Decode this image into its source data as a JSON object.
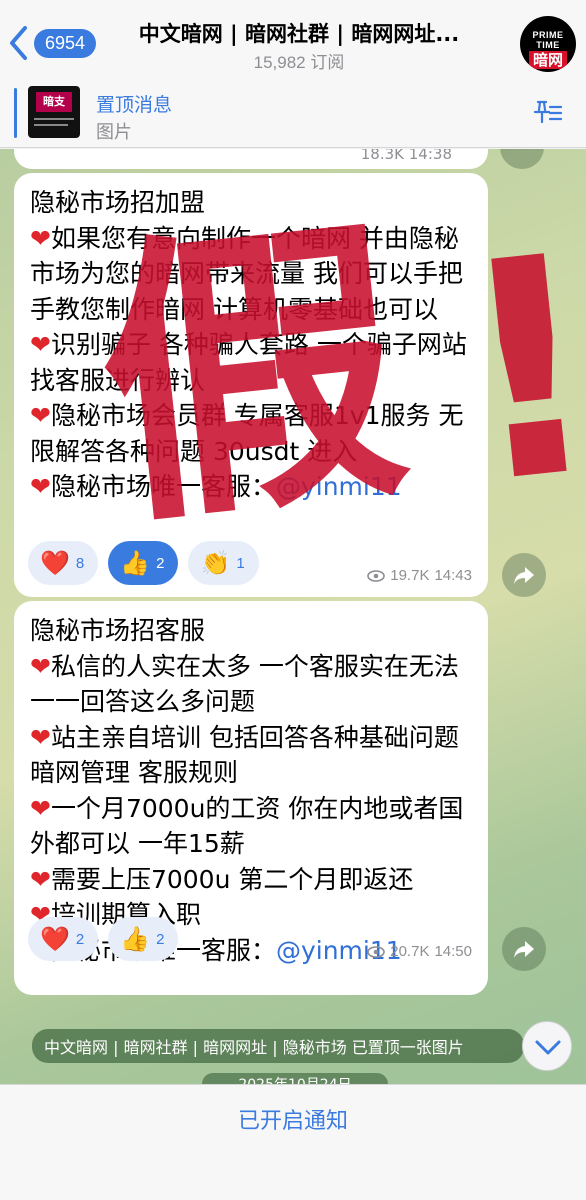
{
  "header": {
    "back_count": "6954",
    "title": "中文暗网 | 暗网社群 | 暗网网址...",
    "subscribers": "15,982 订阅",
    "avatar_line1": "PRIME TIME",
    "avatar_line2": "暗网"
  },
  "pinned": {
    "title": "置顶消息",
    "subtitle": "图片",
    "thumb_label": "暗支",
    "icon": "pin-list-icon"
  },
  "previous_message": {
    "meta": "18.3K 14:38"
  },
  "messages": [
    {
      "lines": [
        {
          "heart": false,
          "text": "隐秘市场招加盟"
        },
        {
          "heart": true,
          "text": "如果您有意向制作一个暗网 并由隐秘市场为您的暗网带来流量 我们可以手把手教您制作暗网 计算机零基础也可以"
        },
        {
          "heart": true,
          "text": "识别骗子 各种骗人套路 一个骗子网站 找客服进行辨认"
        },
        {
          "heart": true,
          "text": "隐秘市场会员群 专属客服1v1服务 无限解答各种问题 30usdt 进入"
        },
        {
          "heart": true,
          "text": "隐秘市场唯一客服：",
          "mention": "@yinmi11"
        }
      ],
      "reactions": [
        {
          "emoji": "❤️",
          "count": "8",
          "active": false
        },
        {
          "emoji": "👍",
          "count": "2",
          "active": true
        },
        {
          "emoji": "👏",
          "count": "1",
          "active": false
        }
      ],
      "views": "19.7K",
      "time": "14:43"
    },
    {
      "lines": [
        {
          "heart": false,
          "text": "隐秘市场招客服"
        },
        {
          "heart": true,
          "text": "私信的人实在太多 一个客服实在无法一一回答这么多问题"
        },
        {
          "heart": true,
          "text": "站主亲自培训 包括回答各种基础问题 暗网管理 客服规则"
        },
        {
          "heart": true,
          "text": "一个月7000u的工资 你在内地或者国外都可以 一年15薪"
        },
        {
          "heart": true,
          "text": "需要上压7000u 第二个月即返还"
        },
        {
          "heart": true,
          "text": "培训期算入职"
        },
        {
          "heart": true,
          "text": "隐秘市场唯一客服：",
          "mention": "@yinmi11"
        }
      ],
      "reactions": [
        {
          "emoji": "❤️",
          "count": "2",
          "active": false
        },
        {
          "emoji": "👍",
          "count": "2",
          "active": false
        }
      ],
      "views": "20.7K",
      "time": "14:50"
    }
  ],
  "service_message": "中文暗网 | 暗网社群 | 暗网网址 | 隐秘市场 已置顶一张图片",
  "date_pill": "2025年10月24日",
  "overlay": {
    "char": "假",
    "mark": "!",
    "color": "#c8102e"
  },
  "bottom": {
    "notify_label": "已开启通知"
  }
}
